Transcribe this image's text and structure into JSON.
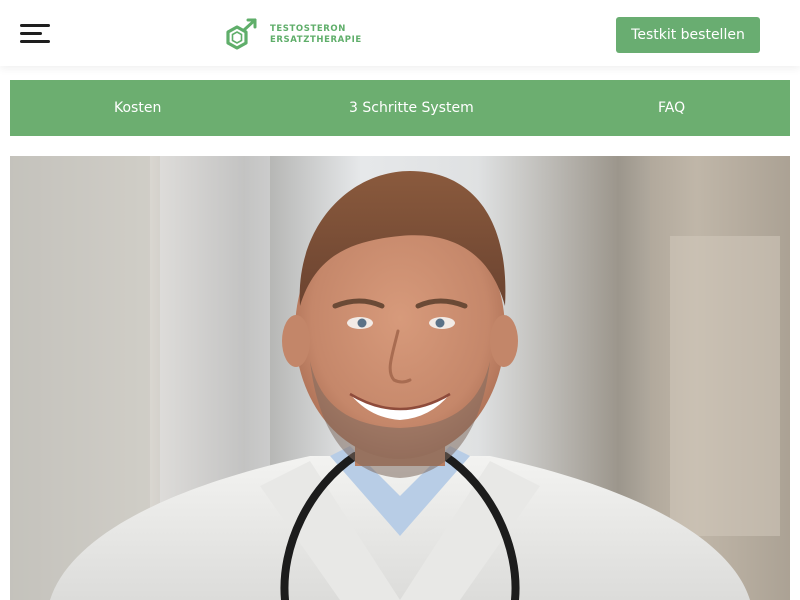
{
  "header": {
    "menu_icon": "hamburger-menu-icon",
    "logo": {
      "icon": "male-symbol-hexagon-icon",
      "line1": "TESTOSTERON",
      "line2": "ERSATZTHERAPIE"
    },
    "cta_label": "Testkit bestellen"
  },
  "nav": {
    "items": [
      {
        "label": "Kosten"
      },
      {
        "label": "3 Schritte System"
      },
      {
        "label": "FAQ"
      }
    ]
  },
  "hero": {
    "image": "smiling-male-doctor-photo"
  },
  "colors": {
    "brand_green": "#69ad71",
    "nav_green": "#6cae70",
    "logo_green": "#5fae6a",
    "background": "#ffffff"
  }
}
